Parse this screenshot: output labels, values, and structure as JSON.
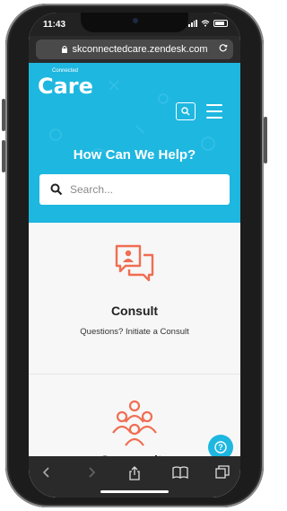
{
  "status_bar": {
    "time": "11:43"
  },
  "browser": {
    "url": "skconnectedcare.zendesk.com"
  },
  "header": {
    "logo_main": "Care",
    "logo_small": "Connected"
  },
  "hero": {
    "title": "How Can We Help?",
    "search_placeholder": "Search..."
  },
  "cards": [
    {
      "title": "Consult",
      "subtitle": "Questions? Initiate a Consult"
    },
    {
      "title": "Community"
    }
  ],
  "help_button": {
    "label": "?"
  },
  "colors": {
    "accent": "#1eb7e0",
    "icon_orange": "#f06e52"
  },
  "icons": [
    "lock-icon",
    "reload-icon",
    "search-icon",
    "menu-icon",
    "consult-icon",
    "community-icon",
    "help-icon",
    "back-icon",
    "forward-icon",
    "share-icon",
    "bookmarks-icon",
    "tabs-icon"
  ]
}
